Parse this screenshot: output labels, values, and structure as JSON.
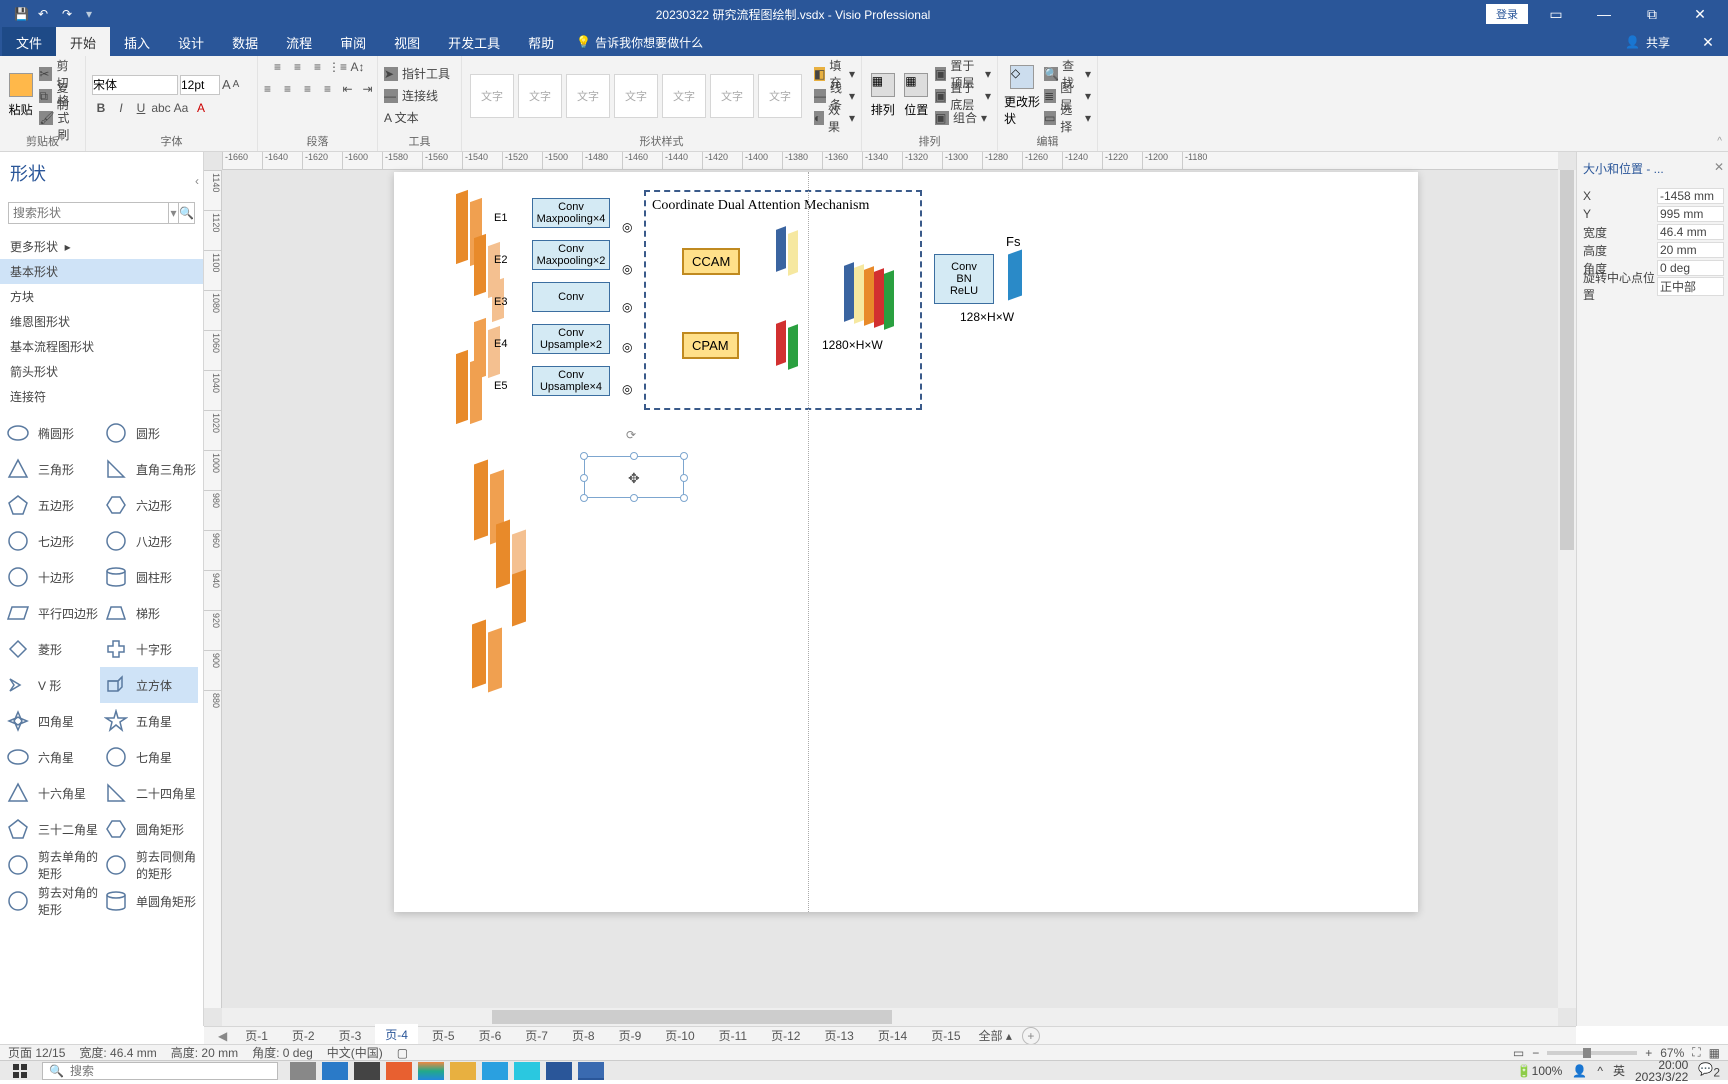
{
  "titlebar": {
    "doc": "20230322 研究流程图绘制.vsdx  -  Visio Professional",
    "login": "登录"
  },
  "tabs": {
    "file": "文件",
    "home": "开始",
    "insert": "插入",
    "design": "设计",
    "data": "数据",
    "process": "流程",
    "review": "审阅",
    "view": "视图",
    "devtools": "开发工具",
    "help": "帮助",
    "tellme": "告诉我你想要做什么",
    "share": "共享"
  },
  "ribbon": {
    "clipboard": {
      "paste": "粘贴",
      "cut": "剪切",
      "copy": "复制",
      "format_painter": "格式刷",
      "label": "剪贴板"
    },
    "font": {
      "name": "宋体",
      "size": "12pt",
      "label": "字体"
    },
    "paragraph": {
      "label": "段落"
    },
    "tools": {
      "pointer": "指针工具",
      "connector": "连接线",
      "text": "A 文本",
      "label": "工具"
    },
    "styles": {
      "slot": "文字",
      "label": "形状样式",
      "fill": "填充",
      "line": "线条",
      "effects": "效果"
    },
    "arrange": {
      "align": "排列",
      "position": "位置",
      "front": "置于顶层",
      "back": "置于底层",
      "group": "组合",
      "label": "排列"
    },
    "edit": {
      "change": "更改形状",
      "find": "查找",
      "layer": "图层",
      "select": "选择",
      "label": "编辑"
    }
  },
  "shapespane": {
    "title": "形状",
    "search_ph": "搜索形状",
    "more": "更多形状",
    "stencils": [
      "基本形状",
      "方块",
      "维恩图形状",
      "基本流程图形状",
      "箭头形状",
      "连接符"
    ],
    "shapes": [
      [
        "椭圆形",
        "圆形"
      ],
      [
        "三角形",
        "直角三角形"
      ],
      [
        "五边形",
        "六边形"
      ],
      [
        "七边形",
        "八边形"
      ],
      [
        "十边形",
        "圆柱形"
      ],
      [
        "平行四边形",
        "梯形"
      ],
      [
        "菱形",
        "十字形"
      ],
      [
        "V 形",
        "立方体"
      ],
      [
        "四角星",
        "五角星"
      ],
      [
        "六角星",
        "七角星"
      ],
      [
        "十六角星",
        "二十四角星"
      ],
      [
        "三十二角星",
        "圆角矩形"
      ],
      [
        "剪去单角的矩形",
        "剪去同侧角的矩形"
      ],
      [
        "剪去对角的矩形",
        "单圆角矩形"
      ]
    ],
    "selected": "立方体"
  },
  "canvas": {
    "hruler": [
      "-1660",
      "-1640",
      "-1620",
      "-1600",
      "-1580",
      "-1560",
      "-1540",
      "-1520",
      "-1500",
      "-1480",
      "-1460",
      "-1440",
      "-1420",
      "-1400",
      "-1380",
      "-1360",
      "-1340",
      "-1320",
      "-1300",
      "-1280",
      "-1260",
      "-1240",
      "-1220",
      "-1200",
      "-1180"
    ],
    "vruler": [
      "1140",
      "1120",
      "1100",
      "1080",
      "1060",
      "1040",
      "1020",
      "1000",
      "980",
      "960",
      "940",
      "920",
      "900",
      "880"
    ],
    "E_labels": [
      "E1",
      "E2",
      "E3",
      "E4",
      "E5"
    ],
    "conv_boxes": [
      "Conv\nMaxpooling×4",
      "Conv\nMaxpooling×2",
      "Conv",
      "Conv\nUpsample×2",
      "Conv\nUpsample×4"
    ],
    "dash_title": "Coordinate Dual Attention Mechanism",
    "ccam": "CCAM",
    "cpam": "CPAM",
    "dims": "1280×H×W",
    "out_box": "Conv\nBN\nReLU",
    "out_dims": "128×H×W",
    "fs": "Fs"
  },
  "chart_data": {
    "type": "diagram",
    "title": "Coordinate Dual Attention Mechanism",
    "encoder_stages": [
      {
        "name": "E1",
        "op": "Conv, Maxpooling×4"
      },
      {
        "name": "E2",
        "op": "Conv, Maxpooling×2"
      },
      {
        "name": "E3",
        "op": "Conv"
      },
      {
        "name": "E4",
        "op": "Conv, Upsample×2"
      },
      {
        "name": "E5",
        "op": "Conv, Upsample×4"
      }
    ],
    "attention_branches": [
      "CCAM",
      "CPAM"
    ],
    "fused_feature_dims": "1280×H×W",
    "output_block": {
      "ops": [
        "Conv",
        "BN",
        "ReLU"
      ],
      "output": "Fs",
      "dims": "128×H×W"
    }
  },
  "sppane": {
    "title": "大小和位置 - ...",
    "rows": [
      {
        "k": "X",
        "v": "-1458 mm"
      },
      {
        "k": "Y",
        "v": "995 mm"
      },
      {
        "k": "宽度",
        "v": "46.4 mm"
      },
      {
        "k": "高度",
        "v": "20 mm"
      },
      {
        "k": "角度",
        "v": "0 deg"
      },
      {
        "k": "旋转中心点位置",
        "v": "正中部"
      }
    ]
  },
  "pages": {
    "tabs": [
      "页-1",
      "页-2",
      "页-3",
      "页-4",
      "页-5",
      "页-6",
      "页-7",
      "页-8",
      "页-9",
      "页-10",
      "页-11",
      "页-12",
      "页-13",
      "页-14",
      "页-15"
    ],
    "active": "页-4",
    "all": "全部"
  },
  "status": {
    "page": "页面 12/15",
    "w": "宽度: 46.4 mm",
    "h": "高度: 20 mm",
    "angle": "角度: 0 deg",
    "lang": "中文(中国)",
    "zoom": "67%"
  },
  "taskbar": {
    "search_ph": "搜索",
    "battery": "100%",
    "ime": "英",
    "time": "20:00",
    "date": "2023/3/22",
    "notif": "2"
  }
}
